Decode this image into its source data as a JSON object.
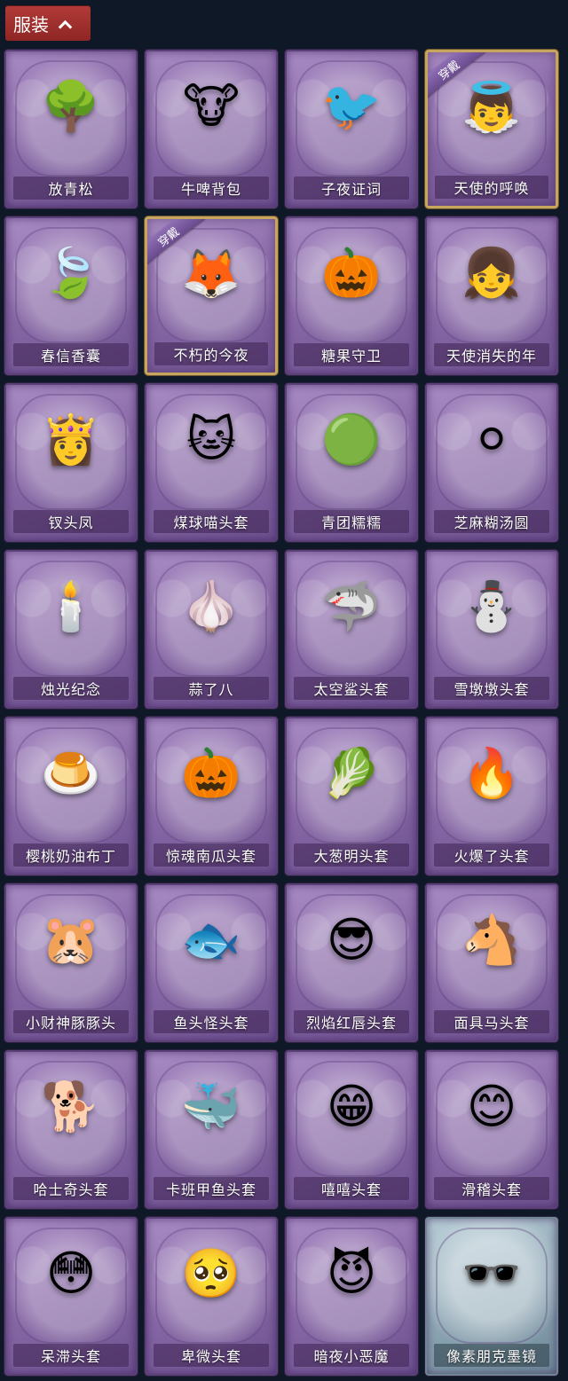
{
  "header": {
    "tab_label": "服装"
  },
  "equipped_badge": "穿戴",
  "items": [
    {
      "label": "放青松",
      "icon": "🌳",
      "equipped": false,
      "name": "bonsai-pine-icon"
    },
    {
      "label": "牛啤背包",
      "icon": "🐮",
      "equipped": false,
      "name": "cow-beer-barrel-icon"
    },
    {
      "label": "子夜证词",
      "icon": "🐦",
      "equipped": false,
      "name": "plague-doctor-crow-icon"
    },
    {
      "label": "天使的呼唤",
      "icon": "👼",
      "equipped": true,
      "name": "angel-doll-icon"
    },
    {
      "label": "春信香囊",
      "icon": "🍃",
      "equipped": false,
      "name": "green-sachet-icon"
    },
    {
      "label": "不朽的今夜",
      "icon": "🦊",
      "equipped": true,
      "name": "pink-fox-cup-icon"
    },
    {
      "label": "糖果守卫",
      "icon": "🎃",
      "equipped": false,
      "name": "pumpkin-scarecrow-icon"
    },
    {
      "label": "天使消失的年",
      "icon": "👧",
      "equipped": false,
      "name": "halo-girl-icon"
    },
    {
      "label": "钗头凤",
      "icon": "👸",
      "equipped": false,
      "name": "phoenix-crown-doll-icon"
    },
    {
      "label": "煤球喵头套",
      "icon": "🐱",
      "equipped": false,
      "name": "black-cat-head-icon"
    },
    {
      "label": "青团糯糯",
      "icon": "🟢",
      "equipped": false,
      "name": "green-dumpling-icon"
    },
    {
      "label": "芝麻糊汤圆",
      "icon": "⚪",
      "equipped": false,
      "name": "rice-ball-icon"
    },
    {
      "label": "烛光纪念",
      "icon": "🕯️",
      "equipped": false,
      "name": "candle-head-icon"
    },
    {
      "label": "蒜了八",
      "icon": "🧄",
      "equipped": false,
      "name": "garlic-head-icon"
    },
    {
      "label": "太空鲨头套",
      "icon": "🦈",
      "equipped": false,
      "name": "shark-head-icon"
    },
    {
      "label": "雪墩墩头套",
      "icon": "⛄",
      "equipped": false,
      "name": "snowman-reindeer-icon"
    },
    {
      "label": "樱桃奶油布丁",
      "icon": "🍮",
      "equipped": false,
      "name": "cherry-pudding-icon"
    },
    {
      "label": "惊魂南瓜头套",
      "icon": "🎃",
      "equipped": false,
      "name": "jack-o-lantern-icon"
    },
    {
      "label": "大葱明头套",
      "icon": "🥬",
      "equipped": false,
      "name": "green-onion-head-icon"
    },
    {
      "label": "火爆了头套",
      "icon": "🔥",
      "equipped": false,
      "name": "fire-head-icon"
    },
    {
      "label": "小财神豚豚头",
      "icon": "🐹",
      "equipped": false,
      "name": "capybara-head-icon"
    },
    {
      "label": "鱼头怪头套",
      "icon": "🐟",
      "equipped": false,
      "name": "fish-head-icon"
    },
    {
      "label": "烈焰红唇头套",
      "icon": "😎",
      "equipped": false,
      "name": "pikachu-sunglasses-icon"
    },
    {
      "label": "面具马头套",
      "icon": "🐴",
      "equipped": false,
      "name": "horse-mask-icon"
    },
    {
      "label": "哈士奇头套",
      "icon": "🐕",
      "equipped": false,
      "name": "husky-sunglasses-icon"
    },
    {
      "label": "卡班甲鱼头套",
      "icon": "🐳",
      "equipped": false,
      "name": "whale-head-icon"
    },
    {
      "label": "嘻嘻头套",
      "icon": "😁",
      "equipped": false,
      "name": "grin-emoji-head-icon"
    },
    {
      "label": "滑稽头套",
      "icon": "😊",
      "equipped": false,
      "name": "blush-emoji-head-icon"
    },
    {
      "label": "呆滞头套",
      "icon": "😳",
      "equipped": false,
      "name": "flushed-emoji-head-icon"
    },
    {
      "label": "卑微头套",
      "icon": "🥺",
      "equipped": false,
      "name": "pleading-emoji-head-icon"
    },
    {
      "label": "暗夜小恶魔",
      "icon": "😈",
      "equipped": false,
      "name": "little-devil-icon"
    },
    {
      "label": "像素朋克墨镜",
      "icon": "🕶️",
      "equipped": false,
      "name": "pixel-sunglasses-icon",
      "special": true
    }
  ]
}
